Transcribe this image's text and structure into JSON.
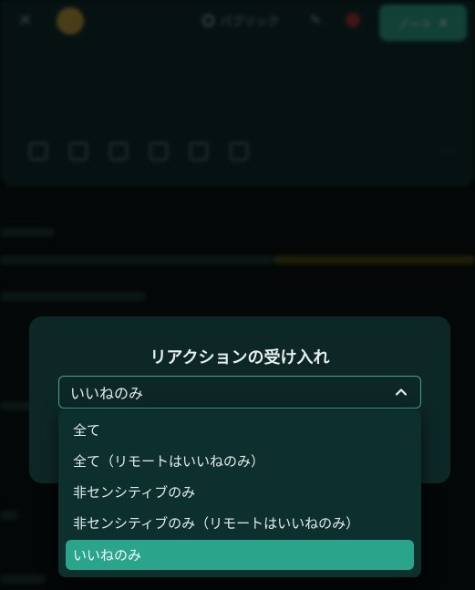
{
  "background": {
    "visibility_label": "パブリック",
    "placeholder": "",
    "submit_label": "ノート"
  },
  "modal": {
    "title": "リアクションの受け入れ",
    "select": {
      "value": "いいねのみ",
      "chevron_icon": "chevron-up-icon"
    }
  },
  "dropdown": {
    "options": [
      {
        "label": "全て",
        "selected": false
      },
      {
        "label": "全て（リモートはいいねのみ）",
        "selected": false
      },
      {
        "label": "非センシティブのみ",
        "selected": false
      },
      {
        "label": "非センシティブのみ（リモートはいいねのみ）",
        "selected": false
      },
      {
        "label": "いいねのみ",
        "selected": true
      }
    ]
  },
  "colors": {
    "accent": "#2aa48a",
    "modal_bg": "#0d2726",
    "page_bg": "#050b0b"
  }
}
